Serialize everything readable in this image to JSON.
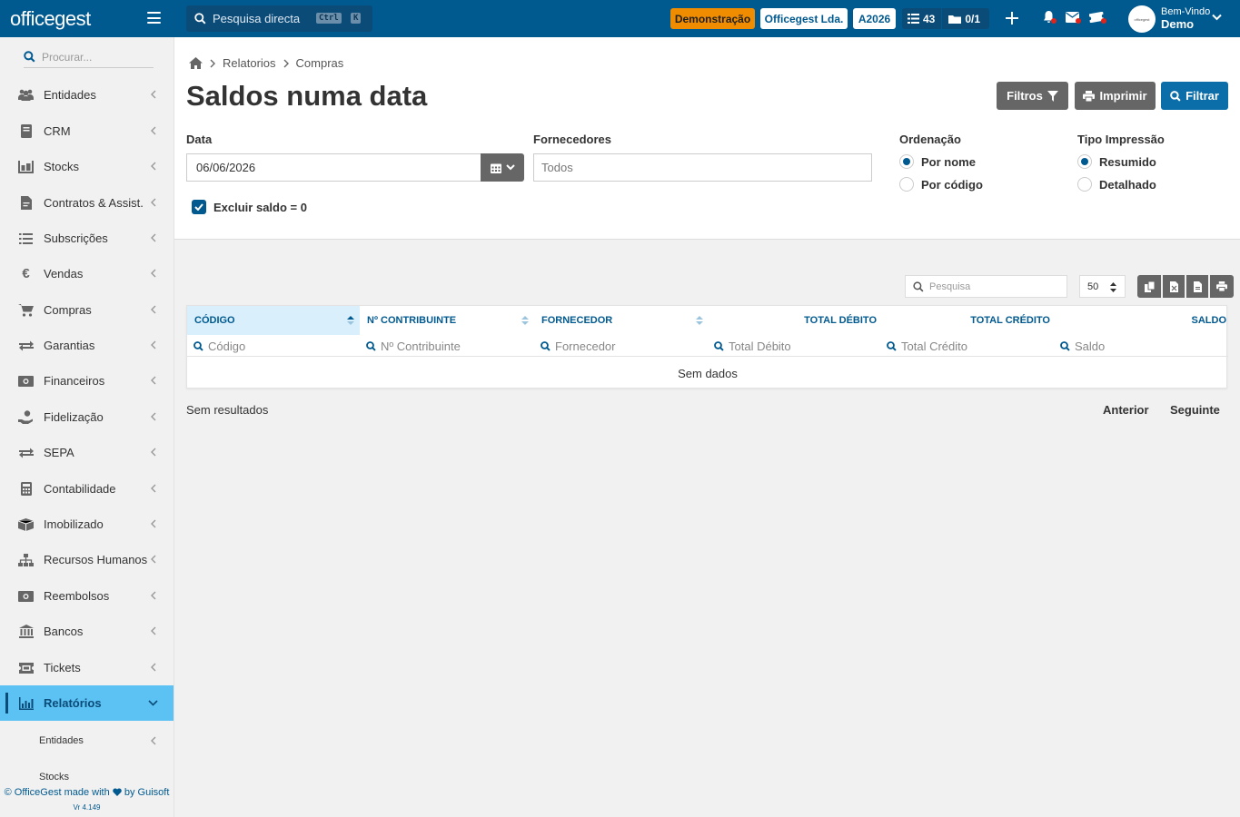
{
  "app": {
    "logo": "officegest"
  },
  "topbar": {
    "search_placeholder": "Pesquisa directa",
    "kbd_ctrl": "Ctrl",
    "kbd_k": "K",
    "badge_demo": "Demonstração",
    "badge_company": "Officegest Lda.",
    "badge_year": "A2026",
    "tasks_count": "43",
    "docs_count": "0/1",
    "welcome_line1": "Bem-Vindo",
    "welcome_name": "Demo",
    "colors": {
      "bar": "#00598f",
      "demo": "#f08c00",
      "alert": "#e0241c"
    }
  },
  "sidebar": {
    "search_placeholder": "Procurar...",
    "items": [
      {
        "label": "Entidades",
        "icon": "users-icon"
      },
      {
        "label": "CRM",
        "icon": "book-icon"
      },
      {
        "label": "Stocks",
        "icon": "pallet-icon"
      },
      {
        "label": "Contratos & Assist.",
        "icon": "contract-icon"
      },
      {
        "label": "Subscrições",
        "icon": "list-icon"
      },
      {
        "label": "Vendas",
        "icon": "euro-icon"
      },
      {
        "label": "Compras",
        "icon": "cart-icon"
      },
      {
        "label": "Garantias",
        "icon": "exchange-icon"
      },
      {
        "label": "Financeiros",
        "icon": "money-icon"
      },
      {
        "label": "Fidelização",
        "icon": "hand-coin-icon"
      },
      {
        "label": "SEPA",
        "icon": "exchange-icon"
      },
      {
        "label": "Contabilidade",
        "icon": "calculator-icon"
      },
      {
        "label": "Imobilizado",
        "icon": "box-icon"
      },
      {
        "label": "Recursos Humanos",
        "icon": "org-chart-icon"
      },
      {
        "label": "Reembolsos",
        "icon": "money-icon"
      },
      {
        "label": "Bancos",
        "icon": "bank-icon"
      },
      {
        "label": "Tickets",
        "icon": "ticket-icon"
      },
      {
        "label": "Relatórios",
        "icon": "chart-icon"
      }
    ],
    "sub_items": [
      {
        "label": "Entidades"
      },
      {
        "label": "Stocks"
      }
    ],
    "footer_text": "© OfficeGest made with",
    "footer_by": "by Guisoft",
    "version": "Vr 4.149"
  },
  "page": {
    "breadcrumb": [
      "Relatorios",
      "Compras"
    ],
    "title": "Saldos numa data",
    "buttons": {
      "filters": "Filtros",
      "print": "Imprimir",
      "filter": "Filtrar"
    },
    "form": {
      "date_label": "Data",
      "date_value": "06/06/2026",
      "suppliers_label": "Fornecedores",
      "suppliers_placeholder": "Todos",
      "order_label": "Ordenação",
      "order_options": [
        "Por nome",
        "Por código"
      ],
      "order_selected": "Por nome",
      "print_type_label": "Tipo Impressão",
      "print_type_options": [
        "Resumido",
        "Detalhado"
      ],
      "print_type_selected": "Resumido",
      "exclude_zero_label": "Excluir saldo = 0",
      "exclude_zero_checked": true
    }
  },
  "table": {
    "search_placeholder": "Pesquisa",
    "page_size": "50",
    "export_icons": [
      "copy-icon",
      "excel-icon",
      "csv-icon",
      "print-icon"
    ],
    "columns": [
      "CÓDIGO",
      "Nº CONTRIBUINTE",
      "FORNECEDOR",
      "TOTAL DÉBITO",
      "TOTAL CRÉDITO",
      "SALDO"
    ],
    "filters": [
      "Código",
      "Nº Contribuinte",
      "Fornecedor",
      "Total Débito",
      "Total Crédito",
      "Saldo"
    ],
    "empty_text": "Sem dados",
    "no_results": "Sem resultados",
    "prev": "Anterior",
    "next": "Seguinte"
  }
}
